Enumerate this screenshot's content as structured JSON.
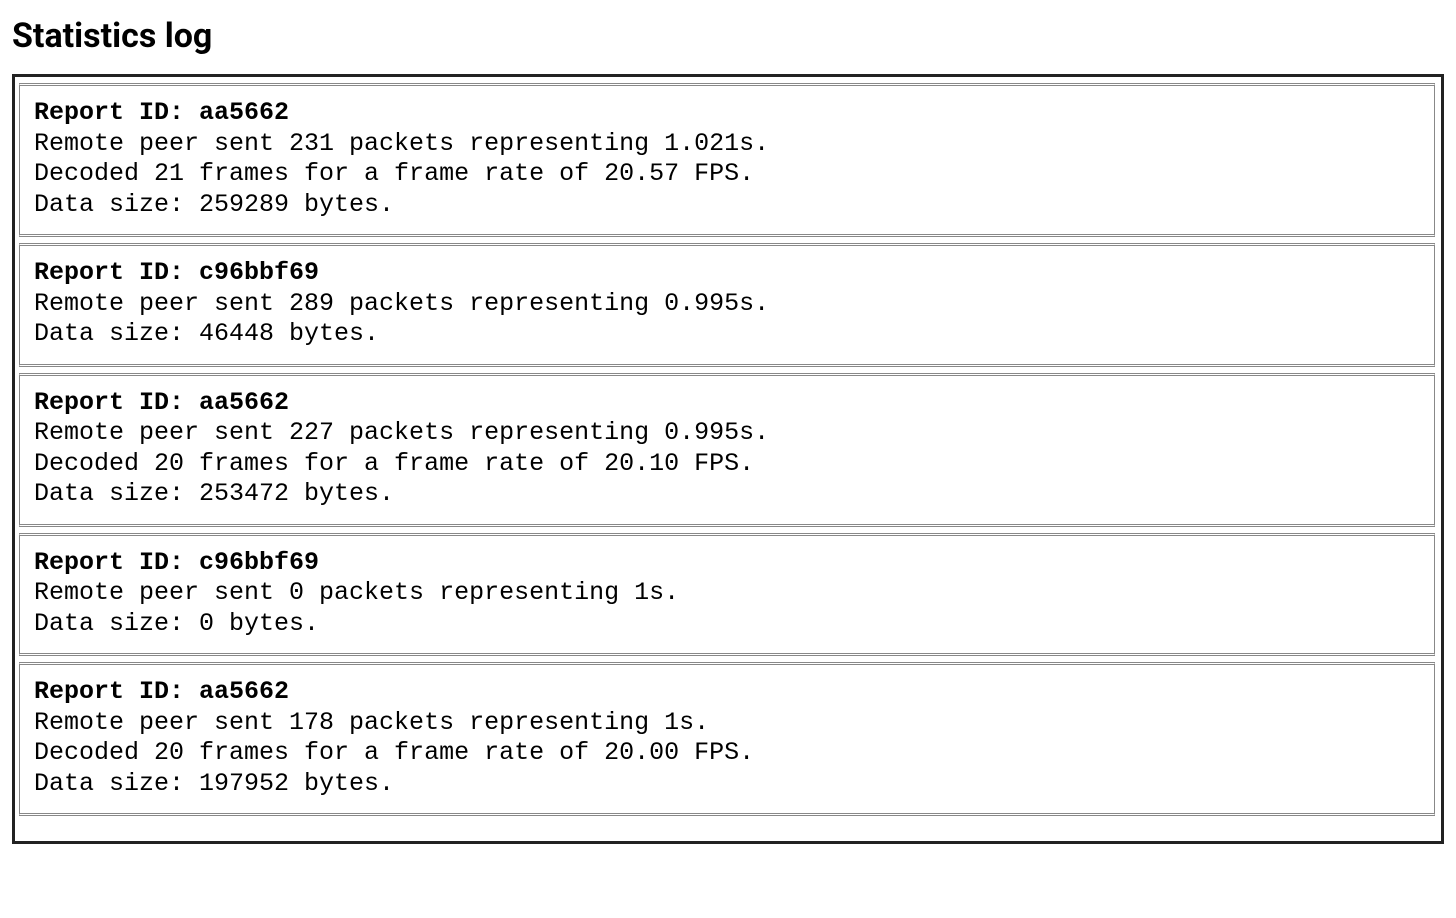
{
  "title": "Statistics log",
  "reports": [
    {
      "header": "Report ID: aa5662",
      "lines": [
        "Remote peer sent 231 packets representing 1.021s.",
        "Decoded 21 frames for a frame rate of 20.57 FPS.",
        "Data size: 259289 bytes."
      ]
    },
    {
      "header": "Report ID: c96bbf69",
      "lines": [
        "Remote peer sent 289 packets representing 0.995s.",
        "Data size: 46448 bytes."
      ]
    },
    {
      "header": "Report ID: aa5662",
      "lines": [
        "Remote peer sent 227 packets representing 0.995s.",
        "Decoded 20 frames for a frame rate of 20.10 FPS.",
        "Data size: 253472 bytes."
      ]
    },
    {
      "header": "Report ID: c96bbf69",
      "lines": [
        "Remote peer sent 0 packets representing 1s.",
        "Data size: 0 bytes."
      ]
    },
    {
      "header": "Report ID: aa5662",
      "lines": [
        "Remote peer sent 178 packets representing 1s.",
        "Decoded 20 frames for a frame rate of 20.00 FPS.",
        "Data size: 197952 bytes."
      ]
    }
  ]
}
